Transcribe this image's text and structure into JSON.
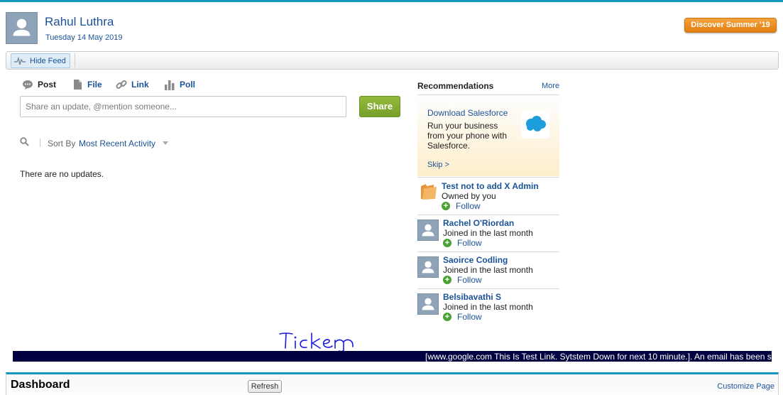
{
  "profile": {
    "name": "Rahul Luthra",
    "date": "Tuesday 14 May 2019",
    "avatar_icon": "user-silhouette-icon"
  },
  "header": {
    "discover_label": "Discover Summer '19"
  },
  "feed_bar": {
    "hide_feed_label": "Hide Feed",
    "hide_feed_icon": "pulse-icon"
  },
  "publisher": {
    "tabs": [
      {
        "label": "Post",
        "icon": "chat-bubble-icon",
        "active": true
      },
      {
        "label": "File",
        "icon": "file-icon",
        "active": false
      },
      {
        "label": "Link",
        "icon": "link-icon",
        "active": false
      },
      {
        "label": "Poll",
        "icon": "bar-chart-icon",
        "active": false
      }
    ],
    "placeholder": "Share an update, @mention someone...",
    "share_label": "Share"
  },
  "feed": {
    "sort_by_label": "Sort By",
    "sort_value": "Most Recent Activity",
    "empty_message": "There are no updates."
  },
  "recommendations": {
    "title": "Recommendations",
    "more_label": "More",
    "promo": {
      "link": "Download Salesforce",
      "text": "Run your business from your phone with Salesforce.",
      "skip": "Skip >",
      "logo_icon": "salesforce-cloud-icon"
    },
    "items": [
      {
        "name": "Test not to add X Admin",
        "subtitle": "Owned by you",
        "follow": "Follow",
        "icon": "folder-icon"
      },
      {
        "name": "Rachel O'Riordan",
        "subtitle": "Joined in the last month",
        "follow": "Follow",
        "icon": "user-silhouette-icon"
      },
      {
        "name": "Saoirce Codling",
        "subtitle": "Joined in the last month",
        "follow": "Follow",
        "icon": "user-silhouette-icon"
      },
      {
        "name": "Belsibavathi S",
        "subtitle": "Joined in the last month",
        "follow": "Follow",
        "icon": "user-silhouette-icon"
      }
    ]
  },
  "annotation": {
    "handwritten_text": "Ticker"
  },
  "ticker": {
    "text": "[www.google.com This Is Test Link. Sytstem Down for next 10 minute.]. An email has been s"
  },
  "dashboard": {
    "title": "Dashboard",
    "refresh_label": "Refresh",
    "customize_label": "Customize Page"
  },
  "colors": {
    "accent": "#1797c0",
    "link": "#1b5297",
    "share_button": "#86ad33",
    "discover_button": "#e88d1e",
    "ticker_background": "#000040"
  }
}
